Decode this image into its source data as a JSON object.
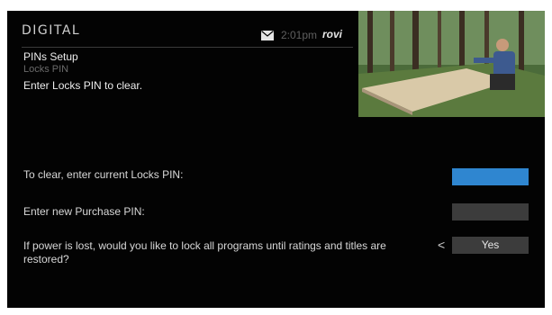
{
  "header": {
    "logo": "DIGITAL",
    "mail_icon": "envelope-icon",
    "time": "2:01pm",
    "brand": "rovi"
  },
  "page": {
    "title": "PINs Setup",
    "subtitle": "Locks PIN",
    "instruction": "Enter Locks PIN to clear."
  },
  "form": {
    "clear_pin_label": "To clear, enter current Locks PIN:",
    "new_purchase_pin_label": "Enter new Purchase PIN:",
    "power_lost_label": "If power is lost, would you like to lock all programs until ratings and titles are restored?",
    "power_lost_value": "Yes",
    "prev_arrow": "<"
  },
  "colors": {
    "active_field": "#2f86d0",
    "idle_field": "#3c3c3c",
    "background": "#030303"
  }
}
